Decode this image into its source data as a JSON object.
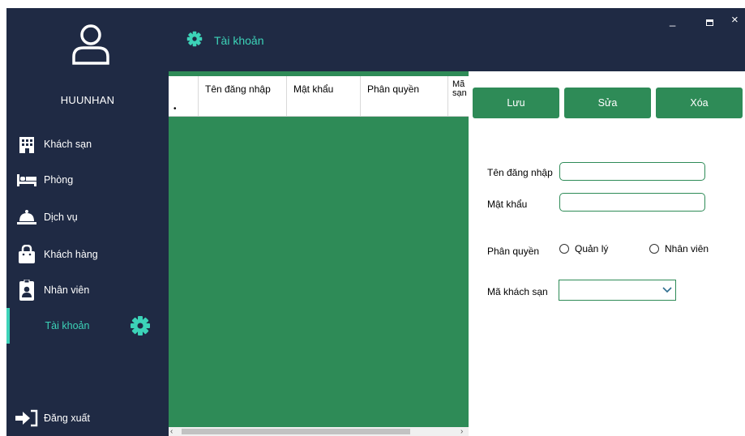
{
  "sidebar": {
    "username": "HUUNHAN",
    "items": [
      {
        "label": "Khách sạn",
        "icon": "hotel-icon"
      },
      {
        "label": "Phòng",
        "icon": "bed-icon"
      },
      {
        "label": "Dịch vụ",
        "icon": "service-bell-icon"
      },
      {
        "label": "Khách hàng",
        "icon": "shopping-bag-icon"
      },
      {
        "label": "Nhân viên",
        "icon": "id-badge-icon"
      },
      {
        "label": "Tài khoản",
        "icon": "gear-icon",
        "active": true
      }
    ],
    "logout_label": "Đăng xuất"
  },
  "header": {
    "title": "Tài khoản",
    "window_controls": [
      "_",
      "▭",
      "×"
    ]
  },
  "grid": {
    "columns": [
      "Tên đăng nhập",
      "Mật khẩu",
      "Phân quyền",
      "Mã khách sạn"
    ],
    "column_visible_text": [
      "Tên đăng nhập",
      "Mật khẩu",
      "Phân quyền",
      "Mã\nsạn"
    ],
    "new_row_marker": "•"
  },
  "form": {
    "buttons": {
      "save": "Lưu",
      "edit": "Sửa",
      "delete": "Xóa"
    },
    "username_label": "Tên đăng nhập",
    "username_value": "",
    "password_label": "Mật khẩu",
    "password_value": "",
    "role_label": "Phân quyền",
    "role_options": [
      "Quản lý",
      "Nhân viên"
    ],
    "hotel_label": "Mã khách sạn",
    "hotel_value": ""
  },
  "colors": {
    "dark": "#1f2a44",
    "accent": "#3cd3b8",
    "green": "#2e8b57"
  }
}
